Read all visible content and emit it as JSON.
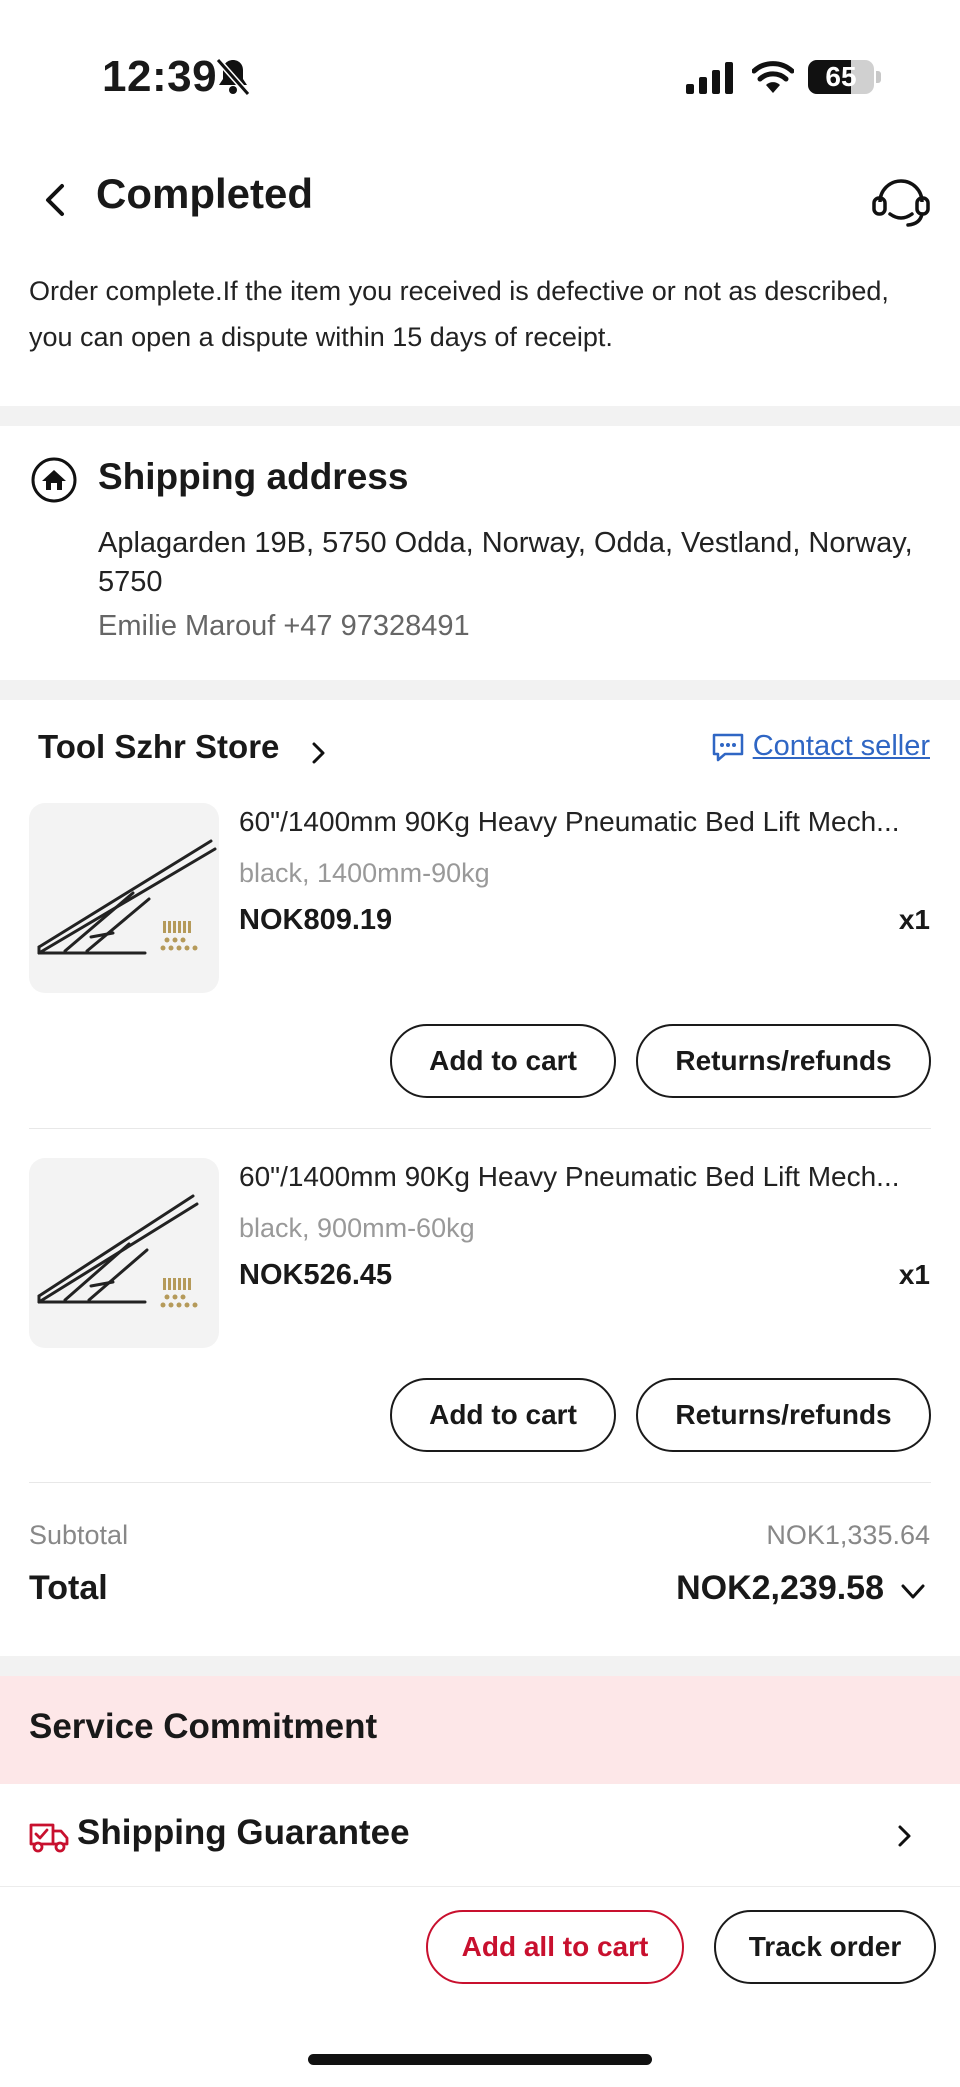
{
  "status_bar": {
    "time": "12:39",
    "battery": "65",
    "battery_level": 0.65
  },
  "header": {
    "title": "Completed"
  },
  "notice": "Order complete.If the item you received is defective or not as described, you can open a dispute within 15 days of receipt.",
  "shipping": {
    "title": "Shipping address",
    "address": "Aplagarden 19B, 5750 Odda, Norway, Odda, Vestland, Norway, 5750",
    "contact": "Emilie Marouf +47 97328491"
  },
  "store": {
    "name": "Tool Szhr Store",
    "contact_label": "Contact seller"
  },
  "items": [
    {
      "title": "60\"/1400mm 90Kg Heavy Pneumatic Bed Lift Mech...",
      "variant": "black, 1400mm-90kg",
      "price": "NOK809.19",
      "qty": "x1",
      "add_to_cart": "Add to cart",
      "returns": "Returns/refunds"
    },
    {
      "title": "60\"/1400mm 90Kg Heavy Pneumatic Bed Lift Mech...",
      "variant": "black, 900mm-60kg",
      "price": "NOK526.45",
      "qty": "x1",
      "add_to_cart": "Add to cart",
      "returns": "Returns/refunds"
    }
  ],
  "totals": {
    "subtotal_label": "Subtotal",
    "subtotal_value": "NOK1,335.64",
    "total_label": "Total",
    "total_value": "NOK2,239.58"
  },
  "service": {
    "title": "Service Commitment",
    "guarantee_title": "Shipping Guarantee"
  },
  "bottom_bar": {
    "add_all": "Add all to cart",
    "track": "Track order"
  },
  "colors": {
    "accent": "#c8102e",
    "link": "#2f66c4",
    "service_band": "#fde7e8"
  },
  "icons": [
    "bell-slash-icon",
    "signal-icon",
    "wifi-icon",
    "back-arrow-icon",
    "support-headset-icon",
    "home-icon",
    "chat-icon",
    "chevron-right-icon",
    "chevron-down-icon",
    "delivery-truck-icon"
  ]
}
